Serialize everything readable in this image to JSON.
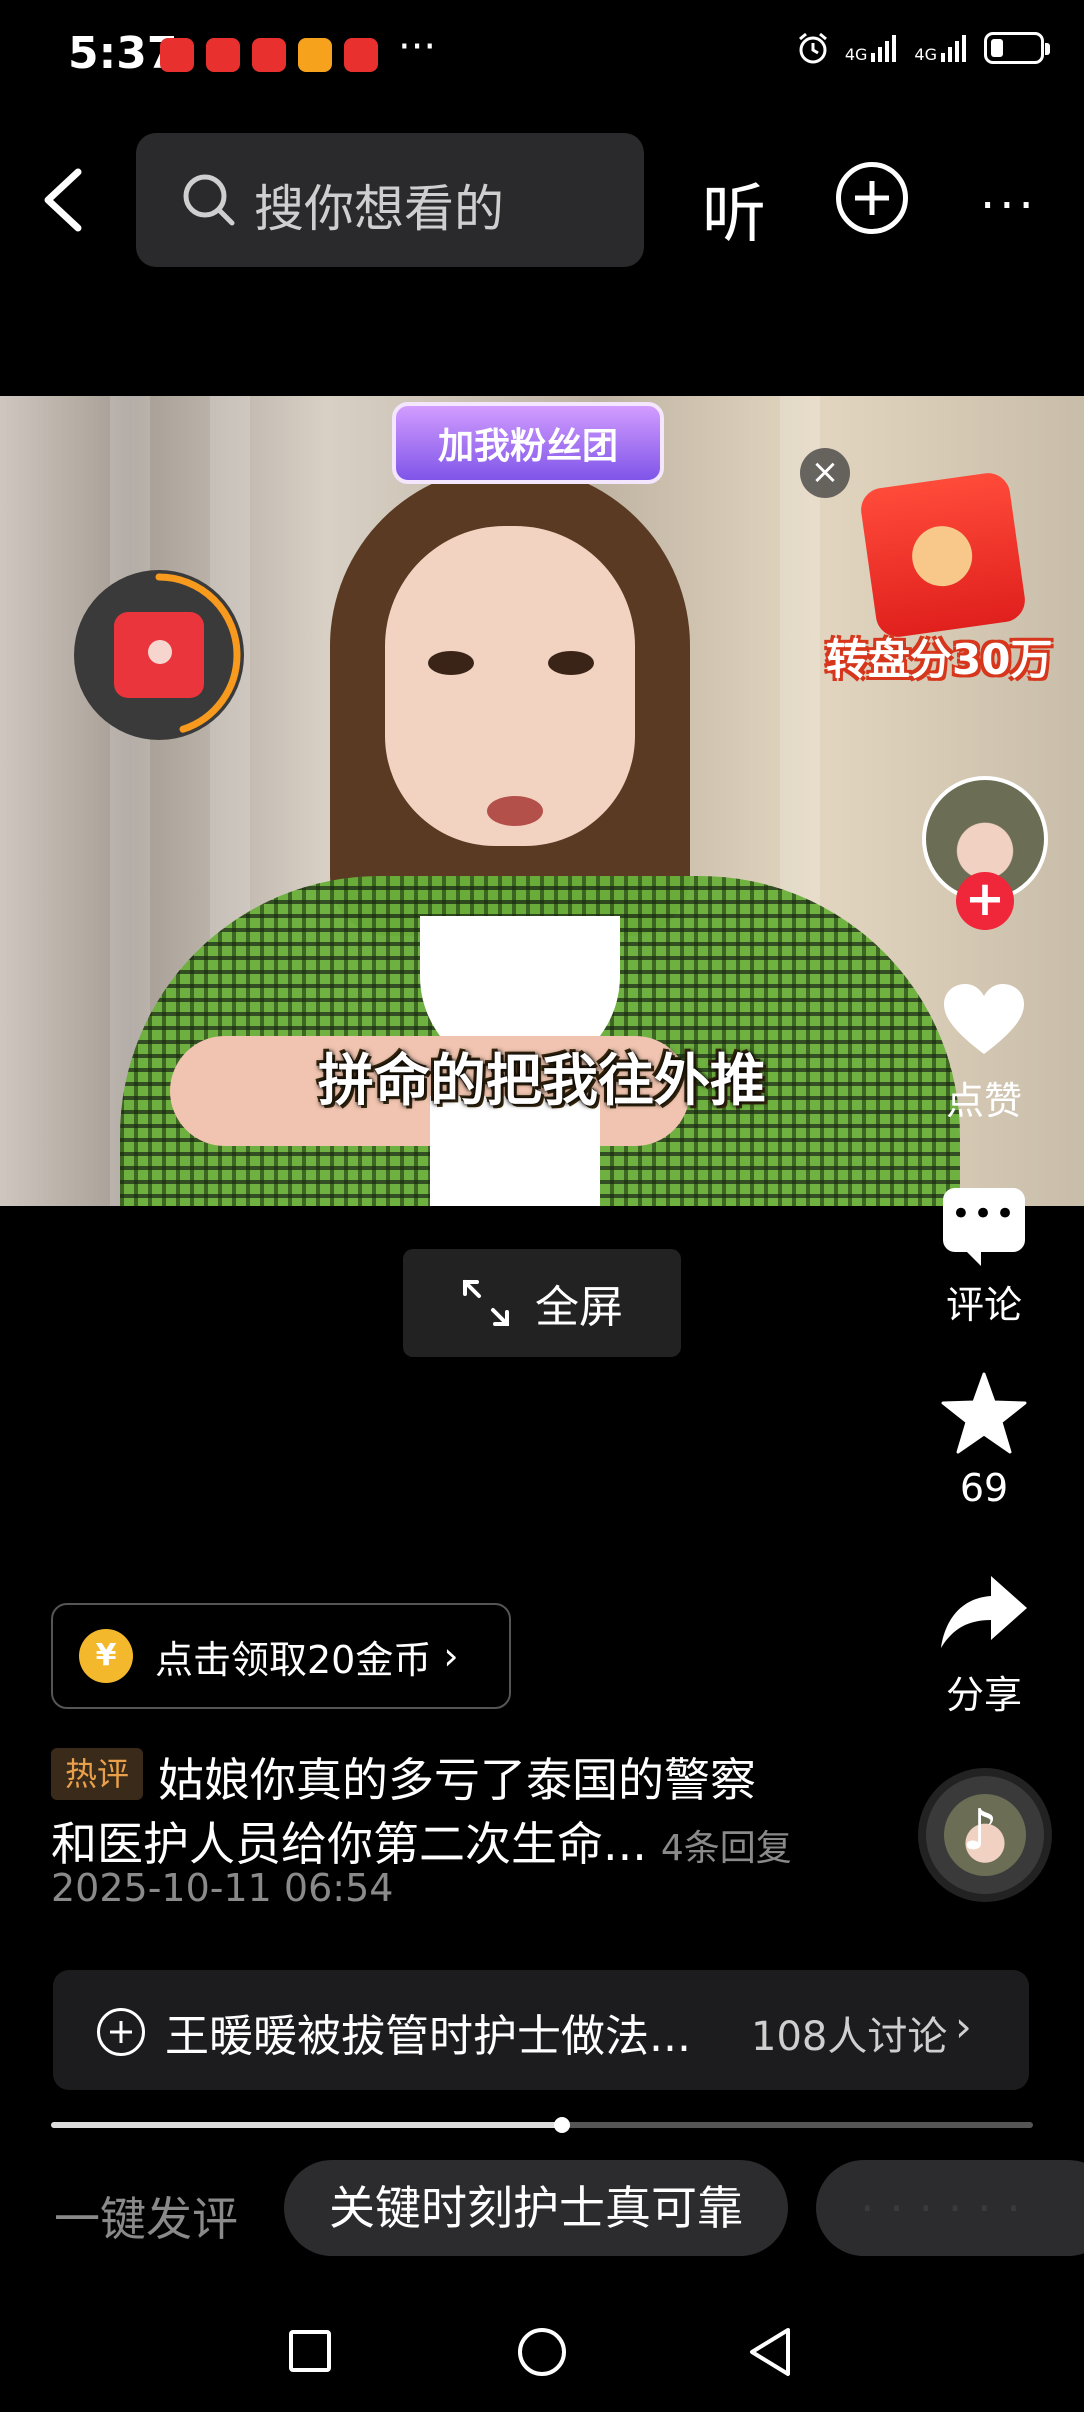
{
  "status_bar": {
    "time": "5:37",
    "more": "···",
    "net1": "4G",
    "net2": "4G",
    "battery_level": 0.25,
    "app_badge_colors": [
      "#e8312f",
      "#e8312f",
      "#e8312f",
      "#f6a21c",
      "#e8312f"
    ]
  },
  "top_bar": {
    "search_placeholder": "搜你想看的",
    "listen_label": "听",
    "more_label": "···"
  },
  "video": {
    "fans_badge": "加我粉丝团",
    "subtitle": "拼命的把我往外推",
    "promo_close": "×",
    "promo_label": "转盘分30万",
    "redpacket_progress": 0.45
  },
  "sidebar": {
    "follow_label": "+",
    "like_label": "点赞",
    "comment_label": "评论",
    "comment_dots": "•••",
    "favorite_count": "69",
    "share_label": "分享"
  },
  "fullscreen": {
    "label": "全屏"
  },
  "coins": {
    "icon": "¥",
    "label": "点击领取20金币",
    "chevron": "›"
  },
  "hot_comment": {
    "tag": "热评",
    "line1": "姑娘你真的多亏了泰国的警察",
    "line2": "和医护人员给你第二次生命...",
    "replies": "4条回复",
    "date": "2025-10-11 06:54"
  },
  "topic": {
    "title": "王暖暖被拔管时护士做法...",
    "count": "108人讨论",
    "chevron": "›"
  },
  "progress": {
    "fraction": 0.52
  },
  "quick_comment": {
    "label": "一键发评",
    "chip1": "关键时刻护士真可靠",
    "chip2": "· · · · · ·"
  },
  "colors": {
    "accent_red": "#f0263b",
    "background": "#000000"
  }
}
